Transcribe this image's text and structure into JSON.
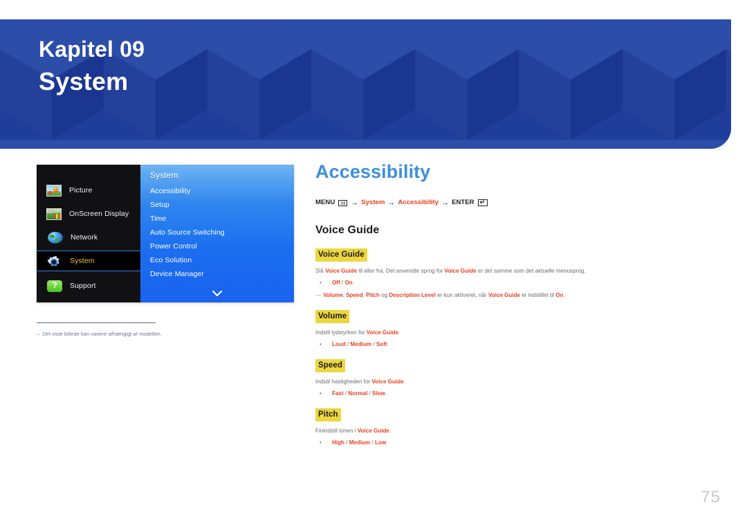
{
  "banner": {
    "chapter_label": "Kapitel 09",
    "chapter_title": "System"
  },
  "osd": {
    "categories": [
      {
        "label": "Picture",
        "icon": "picture-thumbnail-icon",
        "selected": false
      },
      {
        "label": "OnScreen Display",
        "icon": "onscreen-display-thumbnail-icon",
        "selected": false
      },
      {
        "label": "Network",
        "icon": "globe-icon",
        "selected": false
      },
      {
        "label": "System",
        "icon": "gear-icon",
        "selected": true
      },
      {
        "label": "Support",
        "icon": "help-bubble-icon",
        "selected": false
      }
    ],
    "submenu_header": "System",
    "submenu_items": [
      "Accessibility",
      "Setup",
      "Time",
      "Auto Source Switching",
      "Power Control",
      "Eco Solution",
      "Device Manager"
    ],
    "scroll_indicator": "chevron-down-icon"
  },
  "figure_note": {
    "dash": "–",
    "text": "Det viste billede kan variere afhængigt af modellen."
  },
  "content": {
    "heading": "Accessibility",
    "menu_path": {
      "menu_label": "MENU",
      "menu_icon": "menu-grid-icon",
      "arrow": "→",
      "step_system": "System",
      "step_accessibility": "Accessibility",
      "enter_label": "ENTER",
      "enter_icon": "enter-key-icon"
    },
    "section_title": "Voice Guide",
    "blocks": [
      {
        "head": "Voice Guide",
        "body_parts": [
          {
            "t": "Slå ",
            "style": "plain"
          },
          {
            "t": "Voice Guide",
            "style": "accent"
          },
          {
            "t": " til eller fra. Det anvendte sprog for ",
            "style": "plain"
          },
          {
            "t": "Voice Guide",
            "style": "accent"
          },
          {
            "t": " er det samme som det aktuelle menusprog.",
            "style": "plain"
          }
        ],
        "bullet": "•",
        "options": [
          {
            "t": "Off",
            "style": "accent"
          },
          {
            "t": " / ",
            "style": "sep"
          },
          {
            "t": "On",
            "style": "accent"
          }
        ],
        "note": {
          "dash": "—",
          "parts": [
            {
              "t": "Volume",
              "style": "accent"
            },
            {
              "t": ", ",
              "style": "plain"
            },
            {
              "t": "Speed",
              "style": "accent"
            },
            {
              "t": ", ",
              "style": "plain"
            },
            {
              "t": "Pitch",
              "style": "accent"
            },
            {
              "t": " og ",
              "style": "plain"
            },
            {
              "t": "Description Level",
              "style": "accent"
            },
            {
              "t": " er kun aktiveret, når ",
              "style": "plain"
            },
            {
              "t": "Voice Guide",
              "style": "accent"
            },
            {
              "t": " er indstillet til ",
              "style": "plain"
            },
            {
              "t": "On",
              "style": "accent"
            },
            {
              "t": ".",
              "style": "plain"
            }
          ]
        }
      },
      {
        "head": "Volume",
        "body_parts": [
          {
            "t": "Indstil lydstyrken for ",
            "style": "plain"
          },
          {
            "t": "Voice Guide",
            "style": "accent"
          },
          {
            "t": ".",
            "style": "plain"
          }
        ],
        "bullet": "•",
        "options": [
          {
            "t": "Loud",
            "style": "accent"
          },
          {
            "t": " / ",
            "style": "sep"
          },
          {
            "t": "Medium",
            "style": "accent"
          },
          {
            "t": " / ",
            "style": "sep"
          },
          {
            "t": "Soft",
            "style": "accent"
          }
        ],
        "note": null
      },
      {
        "head": "Speed",
        "body_parts": [
          {
            "t": "Indstil hastigheden for ",
            "style": "plain"
          },
          {
            "t": "Voice Guide",
            "style": "accent"
          },
          {
            "t": ".",
            "style": "plain"
          }
        ],
        "bullet": "•",
        "options": [
          {
            "t": "Fast",
            "style": "accent"
          },
          {
            "t": " / ",
            "style": "sep"
          },
          {
            "t": "Normal",
            "style": "accent"
          },
          {
            "t": " / ",
            "style": "sep"
          },
          {
            "t": "Slow",
            "style": "accent"
          }
        ],
        "note": null
      },
      {
        "head": "Pitch",
        "body_parts": [
          {
            "t": "Finindstil tonen i ",
            "style": "plain"
          },
          {
            "t": "Voice Guide",
            "style": "accent"
          },
          {
            "t": ".",
            "style": "plain"
          }
        ],
        "bullet": "•",
        "options": [
          {
            "t": "High",
            "style": "accent"
          },
          {
            "t": " / ",
            "style": "sep"
          },
          {
            "t": "Medium",
            "style": "accent"
          },
          {
            "t": " / ",
            "style": "sep"
          },
          {
            "t": "Low",
            "style": "accent"
          }
        ],
        "note": null
      }
    ]
  },
  "page_number": "75",
  "colors": {
    "banner_blue": "#1f3d9b",
    "heading_blue": "#3d8fdd",
    "accent_red": "#e8401f",
    "highlight_yellow": "#edd63f",
    "osd_selected_text": "#f5c23a"
  }
}
